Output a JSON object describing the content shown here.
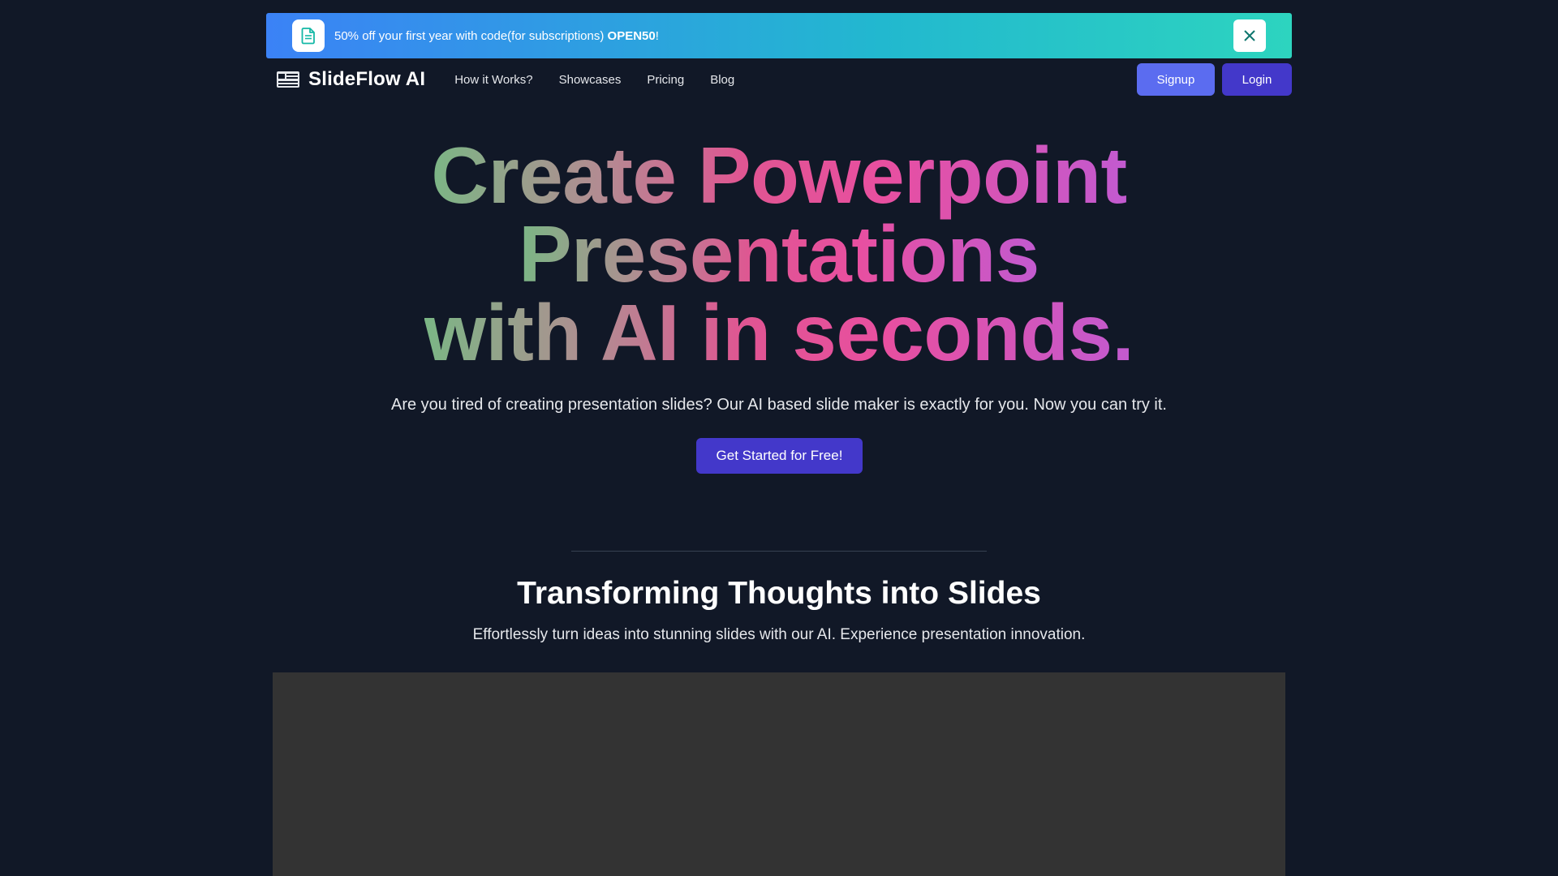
{
  "promo": {
    "text": "50% off your first year with code(for subscriptions) ",
    "code": "OPEN50",
    "suffix": "!",
    "icon": "document-icon",
    "close_icon": "close-icon"
  },
  "nav": {
    "brand": "SlideFlow AI",
    "links": [
      "How it Works?",
      "Showcases",
      "Pricing",
      "Blog"
    ],
    "signup_label": "Signup",
    "login_label": "Login"
  },
  "hero": {
    "line1": "Create Powerpoint",
    "line2": "Presentations",
    "line3": "with AI in seconds.",
    "subtitle": "Are you tired of creating presentation slides? Our AI based slide maker is exactly for you. Now you can try it.",
    "cta_label": "Get Started for Free!"
  },
  "section": {
    "title": "Transforming Thoughts into Slides",
    "subtitle": "Effortlessly turn ideas into stunning slides with our AI. Experience presentation innovation."
  },
  "colors": {
    "background": "#111827",
    "primary_button": "#4338ca",
    "signup_button": "#5b6cf0",
    "video_placeholder": "#333333"
  }
}
